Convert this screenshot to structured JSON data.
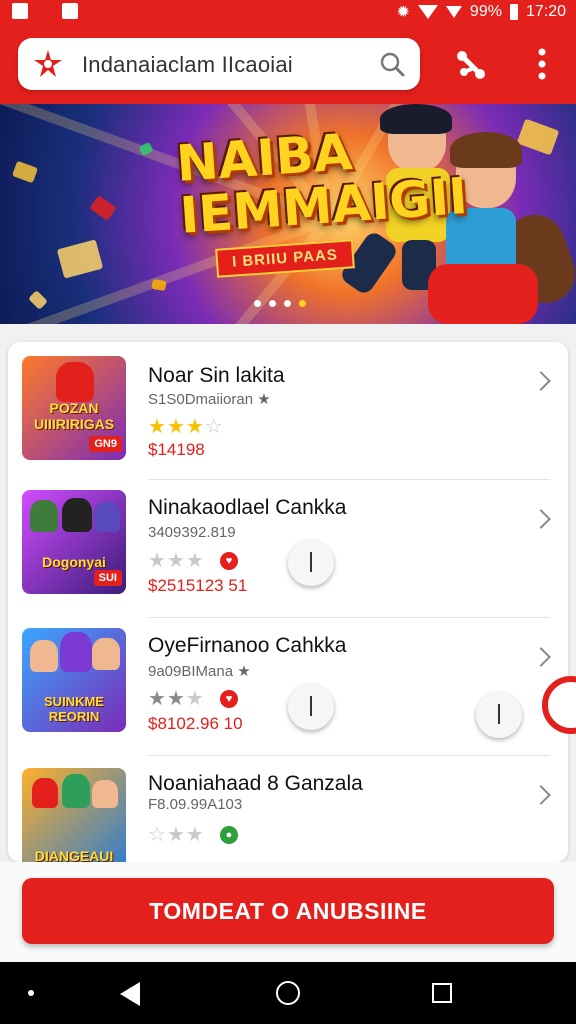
{
  "status_bar": {
    "battery": "99%",
    "time": "17:20"
  },
  "search": {
    "text": "Indanaiaclam IIcaoiai"
  },
  "banner": {
    "title_line1": "NAIBA",
    "title_line2": "IEMMAIGII",
    "tag": "I BRIIU PAAS",
    "pages": 4,
    "active_page": 1
  },
  "list": [
    {
      "thumb_label": "POZAN UIIIRIRIGAS",
      "thumb_badge": "GN9",
      "title": "Noar Sin lakita",
      "subtitle": "S1S0Dmaiioran ★",
      "rating": 3,
      "price": "$14198",
      "thumb_colors": [
        "#ff7a2a",
        "#7b2bb7"
      ]
    },
    {
      "thumb_label": "Dogonyai",
      "thumb_badge": "SUI",
      "title": "Ninakaodlael Cankka",
      "subtitle": "3409392.819",
      "rating": 0,
      "price": "$2515123 51",
      "thumb_colors": [
        "#d24cff",
        "#3a1d7a"
      ]
    },
    {
      "thumb_label": "SUINKME REORIN",
      "thumb_badge": "",
      "title": "OyeFirnanoo Cahkka",
      "subtitle": "9a09BIMana ★",
      "rating": 2,
      "price": "$8102.96 10",
      "thumb_colors": [
        "#3aa8ff",
        "#7b2bb7"
      ]
    },
    {
      "thumb_label": "DIANGEAUI",
      "thumb_badge": "",
      "title": "Noaniahaad 8 Ganzala",
      "subtitle": "F8.09.99A103",
      "rating": 0,
      "price": "",
      "thumb_colors": [
        "#ffb02a",
        "#2a7bd2"
      ]
    }
  ],
  "cta": {
    "label": "TOMDEAT O ANUBSIINE"
  },
  "colors": {
    "brand": "#e3201b",
    "star": "#f5c200"
  }
}
